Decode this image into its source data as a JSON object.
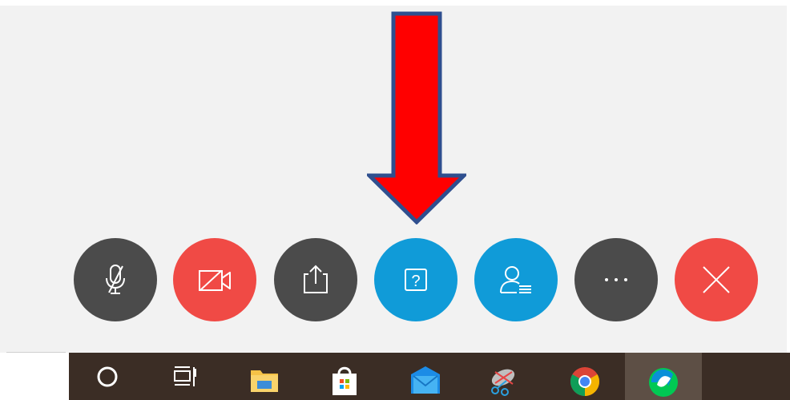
{
  "annotation": {
    "arrow_fill": "#ff0000",
    "arrow_stroke": "#2f4f8f",
    "target": "help-button"
  },
  "meeting_controls": {
    "buttons": [
      {
        "name": "mute-button",
        "icon": "microphone-muted-icon",
        "color": "#4b4b4b"
      },
      {
        "name": "start-video-button",
        "icon": "video-off-icon",
        "color": "#f04a45"
      },
      {
        "name": "share-button",
        "icon": "share-upload-icon",
        "color": "#4b4b4b"
      },
      {
        "name": "help-button",
        "icon": "question-icon",
        "color": "#109bd8",
        "icon_text": "?"
      },
      {
        "name": "participants-button",
        "icon": "participants-list-icon",
        "color": "#109bd8"
      },
      {
        "name": "more-options-button",
        "icon": "more-horizontal-icon",
        "color": "#4b4b4b",
        "icon_text": "..."
      },
      {
        "name": "leave-button",
        "icon": "close-icon",
        "color": "#f04a45"
      }
    ]
  },
  "taskbar": {
    "background": "#3b2d25",
    "items": [
      {
        "name": "cortana-search",
        "icon": "circle-search-icon"
      },
      {
        "name": "task-view",
        "icon": "task-view-icon"
      },
      {
        "name": "file-explorer",
        "icon": "folder-icon"
      },
      {
        "name": "microsoft-store",
        "icon": "store-bag-icon"
      },
      {
        "name": "mail",
        "icon": "mail-envelope-icon"
      },
      {
        "name": "snipping-tool",
        "icon": "scissors-icon"
      },
      {
        "name": "chrome",
        "icon": "chrome-icon"
      },
      {
        "name": "webex",
        "icon": "webex-icon",
        "active": true
      }
    ]
  }
}
